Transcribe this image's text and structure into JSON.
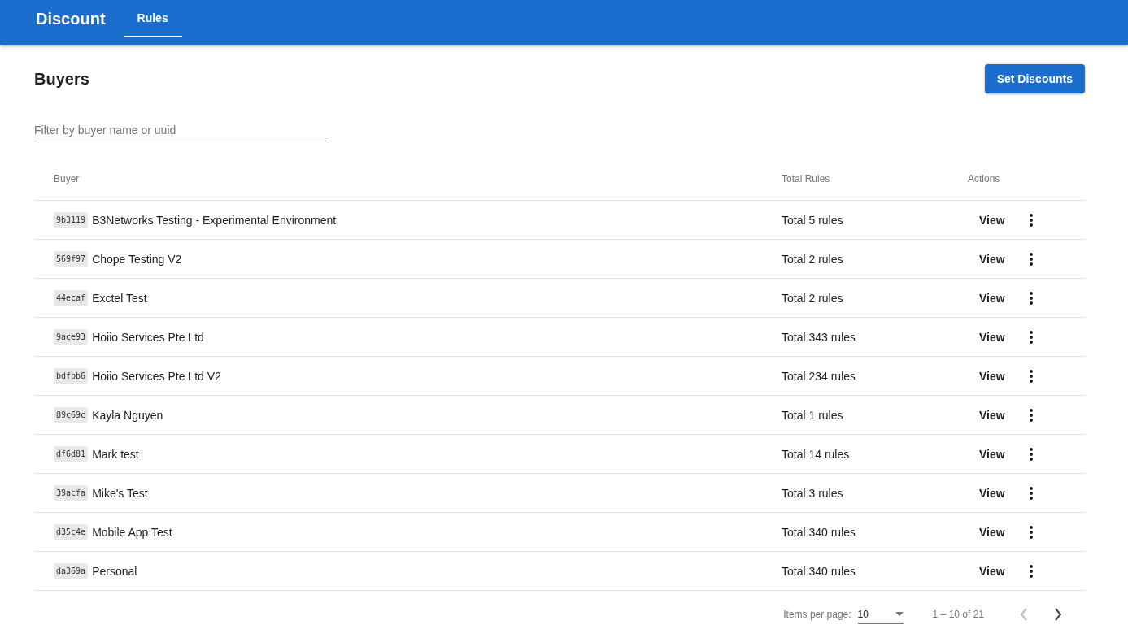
{
  "app_bar": {
    "title": "Discount",
    "tabs": [
      {
        "label": "Rules",
        "selected": true
      }
    ]
  },
  "page": {
    "title": "Buyers",
    "action_button": "Set Discounts"
  },
  "filter": {
    "placeholder": "Filter by buyer name or uuid"
  },
  "table": {
    "columns": [
      "Buyer",
      "Total Rules",
      "Actions"
    ],
    "rows": [
      {
        "uuid": "9b3119",
        "name": "B3Networks Testing - Experimental Environment",
        "total": "Total 5 rules",
        "action": "View"
      },
      {
        "uuid": "569f97",
        "name": "Chope Testing V2",
        "total": "Total 2 rules",
        "action": "View"
      },
      {
        "uuid": "44ecaf",
        "name": "Exctel Test",
        "total": "Total 2 rules",
        "action": "View"
      },
      {
        "uuid": "9ace93",
        "name": "Hoiio Services Pte Ltd",
        "total": "Total 343 rules",
        "action": "View"
      },
      {
        "uuid": "bdfbb6",
        "name": "Hoiio Services Pte Ltd V2",
        "total": "Total 234 rules",
        "action": "View"
      },
      {
        "uuid": "89c69c",
        "name": "Kayla Nguyen",
        "total": "Total 1 rules",
        "action": "View"
      },
      {
        "uuid": "df6d81",
        "name": "Mark test",
        "total": "Total 14 rules",
        "action": "View"
      },
      {
        "uuid": "39acfa",
        "name": "Mike's Test",
        "total": "Total 3 rules",
        "action": "View"
      },
      {
        "uuid": "d35c4e",
        "name": "Mobile App Test",
        "total": "Total 340 rules",
        "action": "View"
      },
      {
        "uuid": "da369a",
        "name": "Personal",
        "total": "Total 340 rules",
        "action": "View"
      }
    ]
  },
  "paginator": {
    "label": "Items per page:",
    "page_size": "10",
    "range": "1 – 10 of 21",
    "previous": {
      "disabled": true
    },
    "next": {
      "disabled": false
    }
  }
}
